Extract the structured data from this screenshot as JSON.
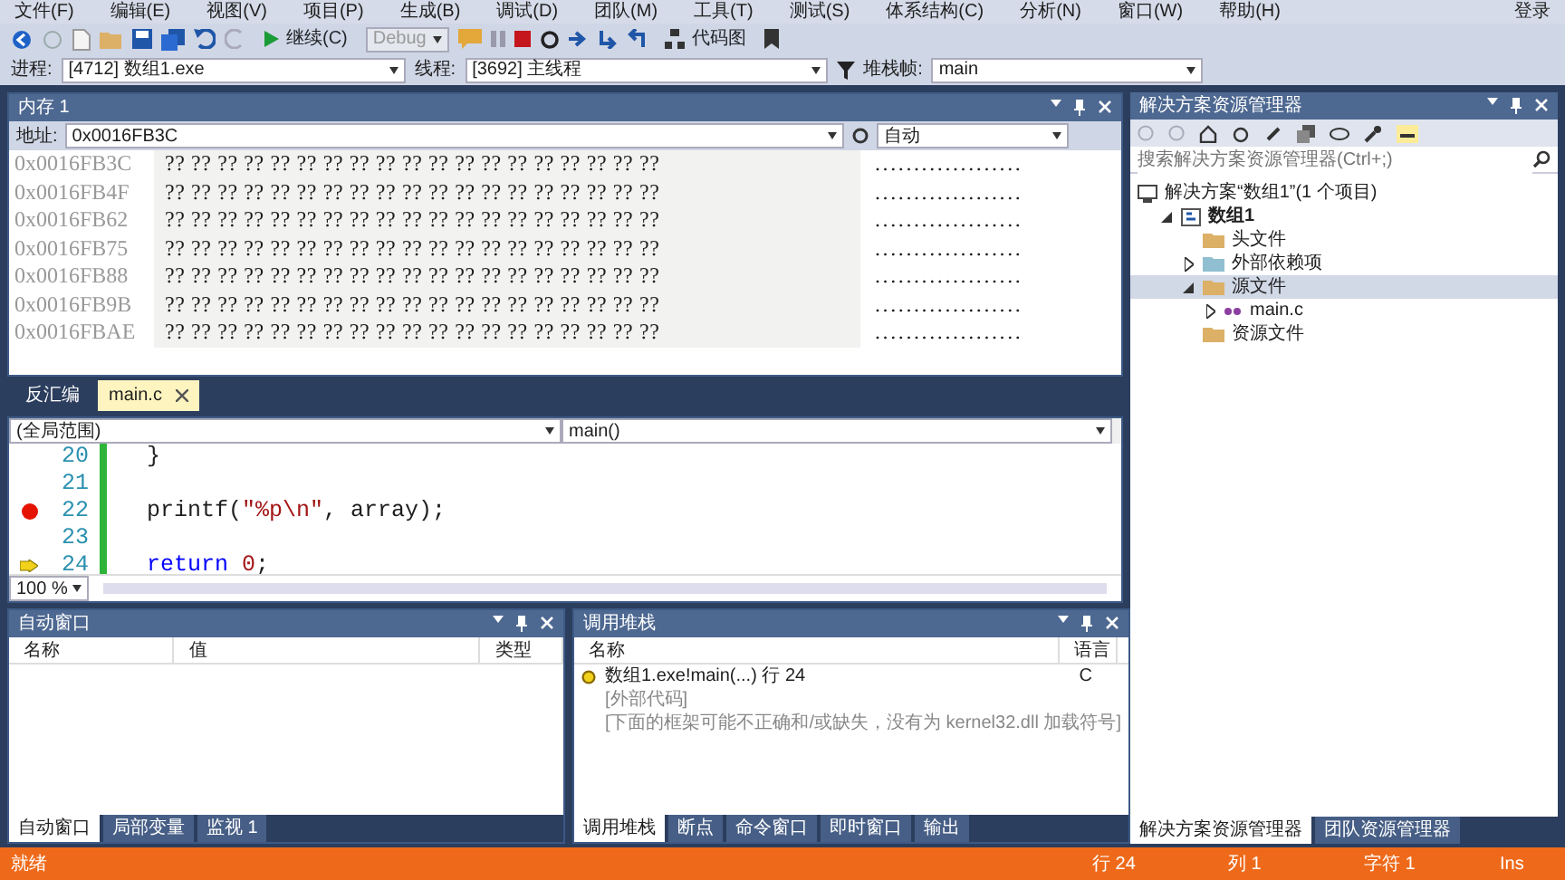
{
  "menu": [
    "文件(F)",
    "编辑(E)",
    "视图(V)",
    "项目(P)",
    "生成(B)",
    "调试(D)",
    "团队(M)",
    "工具(T)",
    "测试(S)",
    "体系结构(C)",
    "分析(N)",
    "窗口(W)",
    "帮助(H)"
  ],
  "account": "登录",
  "toolbar": {
    "continue": "继续(C)",
    "configuration": "Debug",
    "code_map": "代码图"
  },
  "debug_location": [
    {
      "label": "进程:",
      "value": "[4712] 数组1.exe"
    },
    {
      "label": "线程:",
      "value": "[3692] 主线程"
    },
    {
      "label": "堆栈帧:",
      "value": "main"
    }
  ],
  "memory": {
    "title": "内存 1",
    "address_label": "地址:",
    "address": "0x0016FB3C",
    "columns": "自动",
    "rows": [
      {
        "address": "0x0016FB3C",
        "bytes": "?? ?? ?? ?? ?? ?? ?? ?? ?? ?? ?? ?? ?? ?? ?? ?? ?? ?? ??",
        "chars": "..................."
      },
      {
        "address": "0x0016FB4F",
        "bytes": "?? ?? ?? ?? ?? ?? ?? ?? ?? ?? ?? ?? ?? ?? ?? ?? ?? ?? ??",
        "chars": "..................."
      },
      {
        "address": "0x0016FB62",
        "bytes": "?? ?? ?? ?? ?? ?? ?? ?? ?? ?? ?? ?? ?? ?? ?? ?? ?? ?? ??",
        "chars": "..................."
      },
      {
        "address": "0x0016FB75",
        "bytes": "?? ?? ?? ?? ?? ?? ?? ?? ?? ?? ?? ?? ?? ?? ?? ?? ?? ?? ??",
        "chars": "..................."
      },
      {
        "address": "0x0016FB88",
        "bytes": "?? ?? ?? ?? ?? ?? ?? ?? ?? ?? ?? ?? ?? ?? ?? ?? ?? ?? ??",
        "chars": "..................."
      },
      {
        "address": "0x0016FB9B",
        "bytes": "?? ?? ?? ?? ?? ?? ?? ?? ?? ?? ?? ?? ?? ?? ?? ?? ?? ?? ??",
        "chars": "..................."
      },
      {
        "address": "0x0016FBAE",
        "bytes": "?? ?? ?? ?? ?? ?? ?? ?? ?? ?? ?? ?? ?? ?? ?? ?? ?? ?? ??",
        "chars": "..................."
      }
    ]
  },
  "editor": {
    "tabs": [
      {
        "label": "反汇编",
        "selected": false
      },
      {
        "label": "main.c",
        "selected": true
      }
    ],
    "scope": "(全局范围)",
    "member": "main()",
    "lines": [
      {
        "number": "20",
        "breakpoint": false,
        "current": false,
        "tokens": [
          {
            "kind": "plain",
            "text": "}"
          }
        ]
      },
      {
        "number": "21",
        "breakpoint": false,
        "current": false
      },
      {
        "number": "22",
        "breakpoint": true,
        "current": false,
        "tokens": [
          {
            "kind": "plain",
            "text": "printf("
          },
          {
            "kind": "string",
            "text": "\"%p\\n\""
          },
          {
            "kind": "plain",
            "text": ", array);"
          }
        ]
      },
      {
        "number": "23",
        "breakpoint": false,
        "current": false
      },
      {
        "number": "24",
        "breakpoint": false,
        "current": true,
        "tokens": [
          {
            "kind": "keyword",
            "text": "return"
          },
          {
            "kind": "number",
            "text": "0"
          },
          {
            "kind": "plain",
            "text": ";"
          }
        ]
      }
    ],
    "zoom": "100 %"
  },
  "autos": {
    "title": "自动窗口",
    "columns": [
      "名称",
      "值",
      "类型"
    ],
    "tabs": [
      {
        "label": "自动窗口",
        "selected": true
      },
      {
        "label": "局部变量",
        "selected": false
      },
      {
        "label": "监视 1",
        "selected": false
      }
    ]
  },
  "call_stack": {
    "title": "调用堆栈",
    "columns": [
      "名称",
      "语言"
    ],
    "rows": [
      {
        "kind": "frame",
        "current": true,
        "name": "数组1.exe!main(...) 行 24",
        "language": "C"
      },
      {
        "kind": "note",
        "current": false,
        "name": "[外部代码]"
      },
      {
        "kind": "note",
        "current": false,
        "name": "[下面的框架可能不正确和/或缺失，没有为 kernel32.dll 加载符号]"
      }
    ],
    "tabs": [
      {
        "label": "调用堆栈",
        "selected": true
      },
      {
        "label": "断点",
        "selected": false
      },
      {
        "label": "命令窗口",
        "selected": false
      },
      {
        "label": "即时窗口",
        "selected": false
      },
      {
        "label": "输出",
        "selected": false
      }
    ]
  },
  "solution_explorer": {
    "title": "解决方案资源管理器",
    "placeholder": "搜索解决方案资源管理器(Ctrl+;)",
    "tree": [
      {
        "label": "解决方案“数组1”(1 个项目)",
        "kind": "solution",
        "selected": false,
        "children": [
          {
            "label": "数组1",
            "kind": "project",
            "expanded": true,
            "selected": false,
            "children": [
              {
                "label": "头文件",
                "kind": "folder",
                "selected": false
              },
              {
                "label": "外部依赖项",
                "kind": "deps",
                "expanded": false,
                "selected": false
              },
              {
                "label": "源文件",
                "kind": "folder",
                "expanded": true,
                "selected": true,
                "children": [
                  {
                    "label": "main.c",
                    "kind": "file",
                    "expanded": false,
                    "selected": false
                  }
                ]
              },
              {
                "label": "资源文件",
                "kind": "folder",
                "selected": false
              }
            ]
          }
        ]
      }
    ],
    "tabs": [
      {
        "label": "解决方案资源管理器",
        "selected": true
      },
      {
        "label": "团队资源管理器",
        "selected": false
      }
    ]
  },
  "status_bar": {
    "message": "就绪",
    "line": "行 24",
    "column": "列 1",
    "char": "字符 1",
    "mode": "Ins"
  }
}
